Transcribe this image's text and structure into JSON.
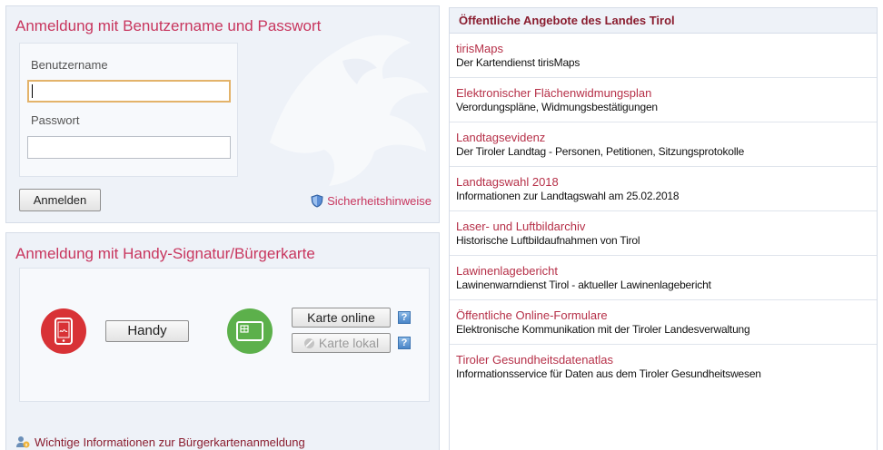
{
  "login": {
    "title": "Anmeldung mit Benutzername und Passwort",
    "username_label": "Benutzername",
    "username_value": "",
    "password_label": "Passwort",
    "password_value": "",
    "submit_label": "Anmelden",
    "security_link": "Sicherheitshinweise",
    "security_icon": "shield-icon"
  },
  "signature": {
    "title": "Anmeldung mit Handy-Signatur/Bürgerkarte",
    "handy_label": "Handy",
    "card_online_label": "Karte online",
    "card_local_label": "Karte lokal",
    "help_label": "?",
    "info_link": "Wichtige Informationen zur Bürgerkartenanmeldung",
    "handy_icon": "mobile-signature-icon",
    "card_icon": "smart-card-icon",
    "info_icon": "person-info-icon",
    "colors": {
      "handy": "#d83236",
      "card": "#5cb04b"
    }
  },
  "offers": {
    "header": "Öffentliche Angebote des Landes Tirol",
    "items": [
      {
        "title": "tirisMaps",
        "desc": "Der Kartendienst tirisMaps"
      },
      {
        "title": "Elektronischer Flächenwidmungsplan",
        "desc": "Verordungspläne, Widmungsbestätigungen"
      },
      {
        "title": "Landtagsevidenz",
        "desc": "Der Tiroler Landtag - Personen, Petitionen, Sitzungsprotokolle"
      },
      {
        "title": "Landtagswahl 2018",
        "desc": "Informationen zur Landtagswahl am 25.02.2018"
      },
      {
        "title": "Laser- und Luftbildarchiv",
        "desc": "Historische Luftbildaufnahmen von Tirol"
      },
      {
        "title": "Lawinenlagebericht",
        "desc": "Lawinenwarndienst Tirol - aktueller Lawinenlagebericht"
      },
      {
        "title": "Öffentliche Online-Formulare",
        "desc": "Elektronische Kommunikation mit der Tiroler Landesverwaltung"
      },
      {
        "title": "Tiroler Gesundheitsdatenatlas",
        "desc": "Informationsservice für Daten aus dem Tiroler Gesundheitswesen"
      }
    ]
  },
  "colors": {
    "accent": "#c8365e",
    "header_text": "#8a1d2f",
    "panel_bg": "#eef2f8"
  }
}
